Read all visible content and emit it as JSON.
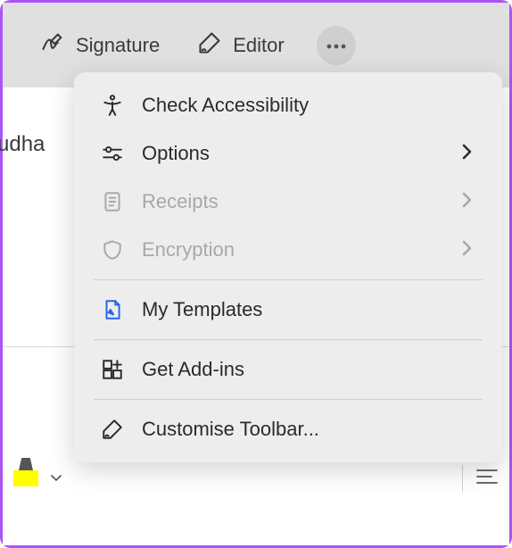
{
  "toolbar": {
    "signature_label": "Signature",
    "editor_label": "Editor"
  },
  "background": {
    "partial_text": "udha"
  },
  "menu": {
    "check_accessibility": "Check Accessibility",
    "options": "Options",
    "receipts": "Receipts",
    "encryption": "Encryption",
    "my_templates": "My Templates",
    "get_addins": "Get Add-ins",
    "customise_toolbar": "Customise Toolbar..."
  }
}
